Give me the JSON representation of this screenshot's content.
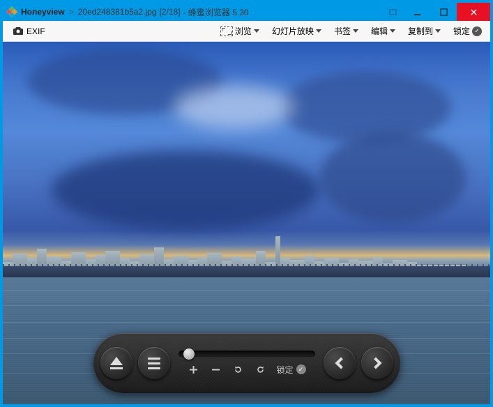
{
  "titlebar": {
    "app_name": "Honeyview",
    "separator": ">",
    "filename": "20ed248381b5a2.jpg",
    "counter": "[2/18]",
    "app_suffix": "- 蜂蜜浏览器 5.30"
  },
  "toolbar": {
    "exif_label": "EXIF",
    "items": {
      "browse": "浏览",
      "slideshow": "幻灯片放映",
      "bookmark": "书签",
      "edit": "编辑",
      "copy_to": "复制到",
      "lock": "锁定"
    }
  },
  "hud": {
    "lock_label": "锁定"
  }
}
